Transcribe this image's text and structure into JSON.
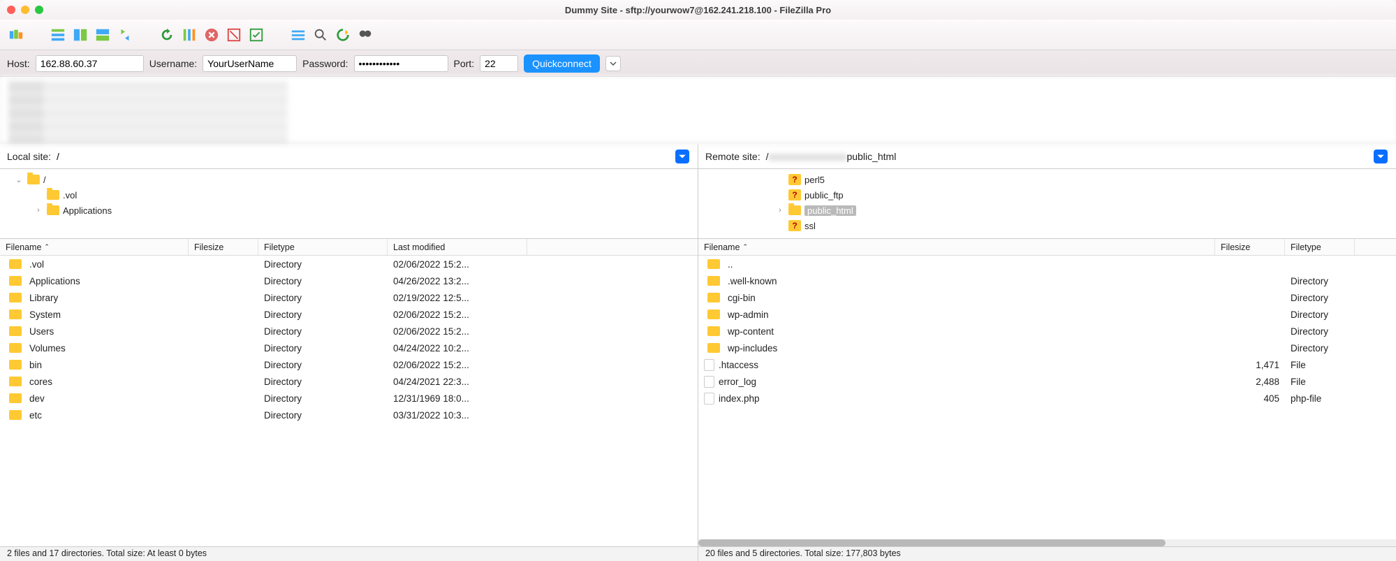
{
  "window": {
    "title": "Dummy Site - sftp://yourwow7@162.241.218.100 - FileZilla Pro"
  },
  "quickconnect": {
    "host_label": "Host:",
    "host_value": "162.88.60.37",
    "user_label": "Username:",
    "user_value": "YourUserName",
    "pass_label": "Password:",
    "pass_value": "••••••••••••",
    "port_label": "Port:",
    "port_value": "22",
    "button": "Quickconnect"
  },
  "local": {
    "label": "Local site:",
    "path": "/",
    "tree": [
      {
        "indent": 0,
        "expander": "⌄",
        "kind": "folder",
        "name": "/"
      },
      {
        "indent": 1,
        "expander": "",
        "kind": "folder",
        "name": ".vol"
      },
      {
        "indent": 1,
        "expander": "›",
        "kind": "folder",
        "name": "Applications"
      }
    ],
    "columns": {
      "name": "Filename",
      "size": "Filesize",
      "type": "Filetype",
      "modified": "Last modified"
    },
    "rows": [
      {
        "name": ".vol",
        "size": "",
        "type": "Directory",
        "modified": "02/06/2022 15:2..."
      },
      {
        "name": "Applications",
        "size": "",
        "type": "Directory",
        "modified": "04/26/2022 13:2..."
      },
      {
        "name": "Library",
        "size": "",
        "type": "Directory",
        "modified": "02/19/2022 12:5..."
      },
      {
        "name": "System",
        "size": "",
        "type": "Directory",
        "modified": "02/06/2022 15:2..."
      },
      {
        "name": "Users",
        "size": "",
        "type": "Directory",
        "modified": "02/06/2022 15:2..."
      },
      {
        "name": "Volumes",
        "size": "",
        "type": "Directory",
        "modified": "04/24/2022 10:2..."
      },
      {
        "name": "bin",
        "size": "",
        "type": "Directory",
        "modified": "02/06/2022 15:2..."
      },
      {
        "name": "cores",
        "size": "",
        "type": "Directory",
        "modified": "04/24/2021 22:3..."
      },
      {
        "name": "dev",
        "size": "",
        "type": "Directory",
        "modified": "12/31/1969 18:0..."
      },
      {
        "name": "etc",
        "size": "",
        "type": "Directory",
        "modified": "03/31/2022 10:3..."
      }
    ],
    "status": "2 files and 17 directories. Total size: At least 0 bytes"
  },
  "remote": {
    "label": "Remote site:",
    "path_prefix": "/",
    "path_suffix": "public_html",
    "tree": [
      {
        "indent": 0,
        "expander": "",
        "kind": "q",
        "name": "perl5"
      },
      {
        "indent": 0,
        "expander": "",
        "kind": "q",
        "name": "public_ftp"
      },
      {
        "indent": 0,
        "expander": "›",
        "kind": "folder",
        "name": "public_html",
        "selected": true
      },
      {
        "indent": 0,
        "expander": "",
        "kind": "q",
        "name": "ssl"
      }
    ],
    "columns": {
      "name": "Filename",
      "size": "Filesize",
      "type": "Filetype"
    },
    "rows": [
      {
        "name": "..",
        "kind": "folder",
        "size": "",
        "type": ""
      },
      {
        "name": ".well-known",
        "kind": "folder",
        "size": "",
        "type": "Directory"
      },
      {
        "name": "cgi-bin",
        "kind": "folder",
        "size": "",
        "type": "Directory"
      },
      {
        "name": "wp-admin",
        "kind": "folder",
        "size": "",
        "type": "Directory"
      },
      {
        "name": "wp-content",
        "kind": "folder",
        "size": "",
        "type": "Directory"
      },
      {
        "name": "wp-includes",
        "kind": "folder",
        "size": "",
        "type": "Directory"
      },
      {
        "name": ".htaccess",
        "kind": "file",
        "size": "1,471",
        "type": "File"
      },
      {
        "name": "error_log",
        "kind": "file",
        "size": "2,488",
        "type": "File"
      },
      {
        "name": "index.php",
        "kind": "file",
        "size": "405",
        "type": "php-file"
      }
    ],
    "status": "20 files and 5 directories. Total size: 177,803 bytes"
  },
  "toolbar_icons": [
    "site-manager-icon",
    "toggle-tree-icon",
    "toggle-log-icon",
    "toggle-queue-icon",
    "sync-browsing-icon",
    "refresh-icon",
    "compare-icon",
    "cancel-icon",
    "disconnect-icon",
    "reconnect-icon",
    "filter-icon",
    "search-icon",
    "process-queue-icon",
    "find-icon"
  ]
}
